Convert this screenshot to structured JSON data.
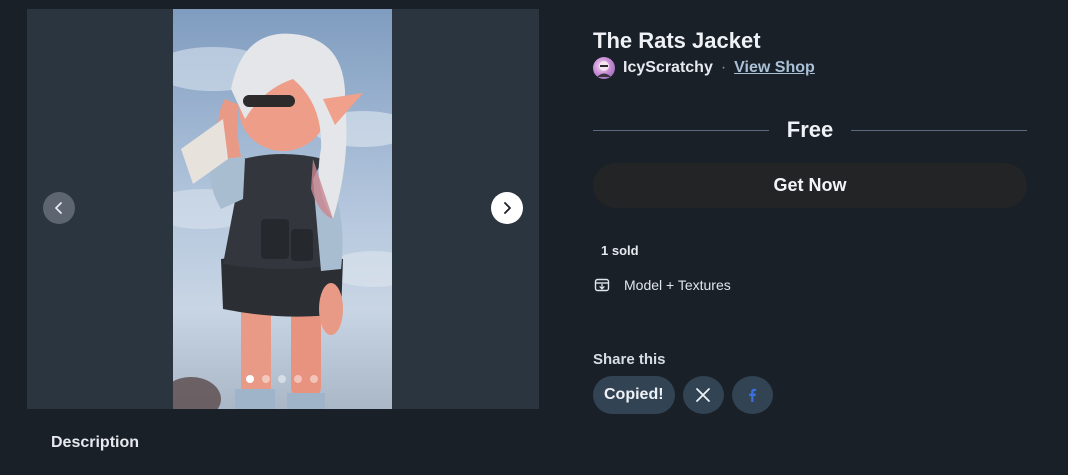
{
  "product": {
    "title": "The Rats Jacket",
    "creator": "IcyScratchy",
    "separator": "·",
    "view_shop_label": "View Shop",
    "price": "Free",
    "cta_label": "Get Now",
    "sold_text": "1 sold",
    "feature_text": "Model + Textures",
    "feature_icon": "box-download-icon"
  },
  "gallery": {
    "slide_count": 5,
    "active_slide": 1,
    "prev_icon": "chevron-left-icon",
    "next_icon": "chevron-right-icon"
  },
  "description": {
    "heading": "Description"
  },
  "share": {
    "heading": "Share this",
    "copied_label": "Copied!",
    "x_icon": "x-logo-icon",
    "facebook_icon": "facebook-logo-icon"
  },
  "colors": {
    "background": "#1a2028",
    "gallery_bg": "#2b3540",
    "cta_bg": "#222426",
    "share_btn_bg": "#324354",
    "link": "#a9c0d8",
    "facebook": "#3b6fe0"
  }
}
